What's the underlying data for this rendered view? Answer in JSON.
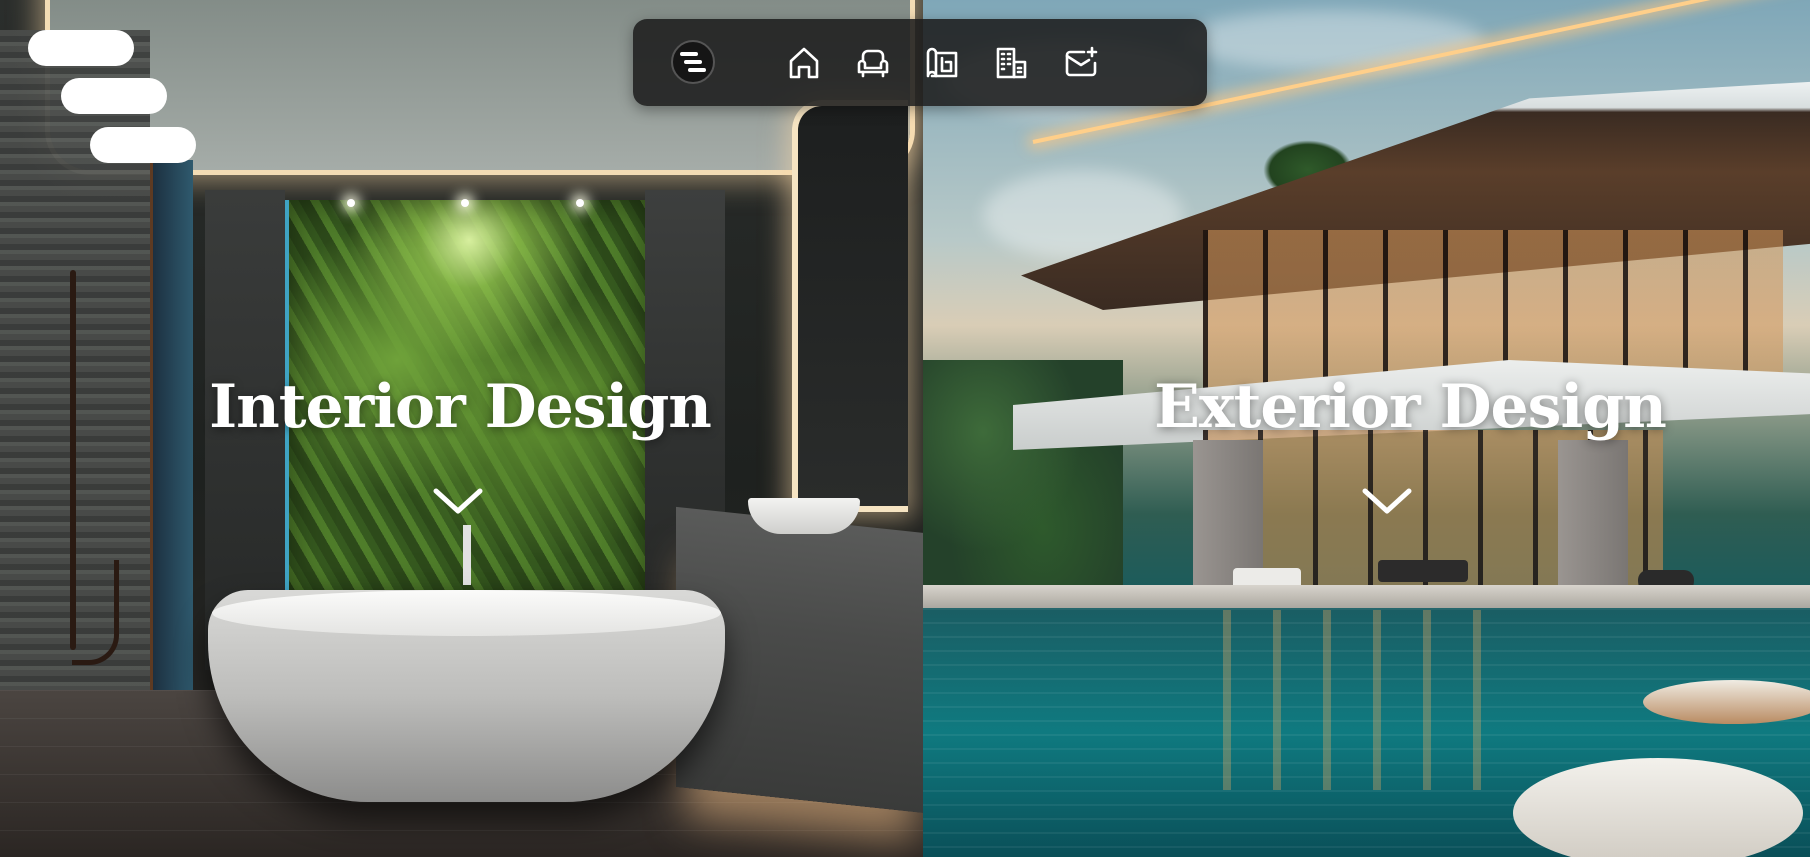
{
  "sections": {
    "interior": {
      "title": "Interior Design",
      "scroll_icon": "chevron-down-icon"
    },
    "exterior": {
      "title": "Exterior Design",
      "scroll_icon": "chevron-down-icon"
    }
  },
  "menu": {
    "icon": "hamburger-menu-icon"
  },
  "nav": {
    "logo_icon": "brand-logo-icon",
    "items": [
      {
        "icon": "home-icon"
      },
      {
        "icon": "armchair-icon"
      },
      {
        "icon": "blueprint-icon"
      },
      {
        "icon": "building-icon"
      },
      {
        "icon": "mail-plus-icon"
      }
    ]
  },
  "colors": {
    "nav_background": "#1c1c1c",
    "text": "#ffffff",
    "accent_light": "#f3dcb4"
  }
}
